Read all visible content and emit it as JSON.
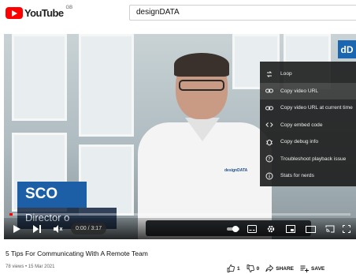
{
  "brand": {
    "logo_text": "YouTube",
    "region": "GB"
  },
  "search": {
    "query": "designDATA"
  },
  "video": {
    "corner_logo": "dD",
    "shirt_logo": "designDATA",
    "lower_third": {
      "name": "SCO",
      "title": "Director o"
    },
    "time_display": "0:00 / 3:17",
    "progress_fraction": 0.0
  },
  "context_menu": {
    "items": [
      {
        "label": "Loop",
        "icon": "loop-icon"
      },
      {
        "label": "Copy video URL",
        "icon": "link-icon"
      },
      {
        "label": "Copy video URL at current time",
        "icon": "link-icon"
      },
      {
        "label": "Copy embed code",
        "icon": "code-icon"
      },
      {
        "label": "Copy debug info",
        "icon": "bug-icon"
      },
      {
        "label": "Troubleshoot playback issue",
        "icon": "help-icon"
      },
      {
        "label": "Stats for nerds",
        "icon": "info-icon"
      }
    ]
  },
  "info": {
    "title": "5 Tips For Communicating With A Remote Team",
    "meta": "78 views • 15 Mar 2021"
  },
  "actions": {
    "likes": "1",
    "dislikes": "0",
    "share": "SHARE",
    "save": "SAVE"
  },
  "colors": {
    "brand_red": "#ff0000",
    "menu_bg": "#1c1c1c",
    "lower_third_blue": "#1c5fa6"
  }
}
